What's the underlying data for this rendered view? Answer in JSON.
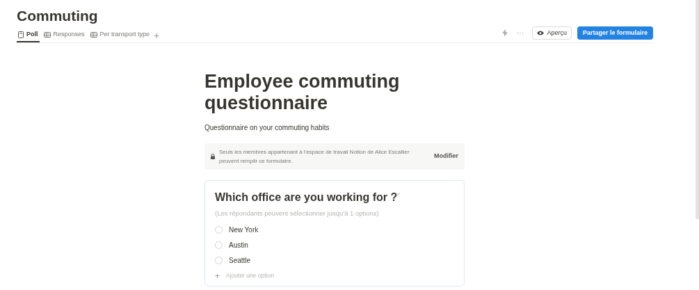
{
  "page": {
    "title": "Commuting"
  },
  "tabs": [
    {
      "label": "Poll",
      "kind": "form",
      "selected": true
    },
    {
      "label": "Responses",
      "kind": "table",
      "selected": false
    },
    {
      "label": "Per transport type",
      "kind": "table",
      "selected": false
    }
  ],
  "add_tab": "+",
  "toolbar": {
    "more": "···",
    "preview_button": "Aperçu",
    "share_button": "Partager le formulaire"
  },
  "form": {
    "title": "Employee commuting questionnaire",
    "description": "Questionnaire on your commuting habits",
    "notice": {
      "text": "Seuls les membres appartenant à l'espace de travail Notion de Alice Escallier peuvent remplir ce formulaire.",
      "action": "Modifier"
    },
    "question": {
      "title": "Which office are you working for ?",
      "required_mark": "*",
      "hint": "(Les répondants peuvent sélectionner jusqu'à 1 options)",
      "options": [
        {
          "label": "New York",
          "selected": false
        },
        {
          "label": "Austin",
          "selected": false
        },
        {
          "label": "Seattle",
          "selected": false
        }
      ],
      "add_option": {
        "icon": "+",
        "label": "Ajouter une option"
      }
    }
  }
}
